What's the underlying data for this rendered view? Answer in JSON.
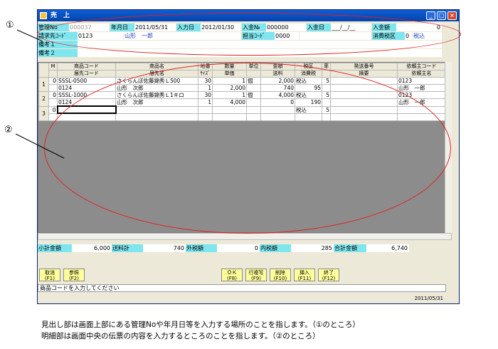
{
  "window": {
    "title": "売　上",
    "min": "_",
    "max": "□",
    "close": "×"
  },
  "header": {
    "kanri_label": "管理No",
    "kanri_value": "000037",
    "nengappi_label": "年月日",
    "nengappi_value": "2011/05/31",
    "nyuryokubi_label": "入力日",
    "nyuryokubi_value": "2012/01/30",
    "nyukin_no_label": "入金№",
    "nyukin_no_value": "000000",
    "nyukinbi_label": "入金日",
    "nyukinbi_value": "___/__/__",
    "nyukin_gaku_label": "入金額",
    "nyukin_gaku_value": "0",
    "seikyu_label": "請求先ｺｰﾄﾞ",
    "seikyu_code": "0123",
    "seikyu_name": "山形　一郎",
    "tanto_label": "担当ｺｰﾄﾞ",
    "tanto_value": "0000",
    "tax_label": "消費税区",
    "tax_code": "0",
    "tax_name": "税込",
    "biko1_label": "備考１",
    "biko2_label": "備考２"
  },
  "detail": {
    "header1": [
      "M",
      "商品コード",
      "商品名",
      "地番",
      "数量",
      "単位",
      "金額",
      "税区",
      "率",
      "発送番号",
      "依頼主コード"
    ],
    "header2": [
      "届先コード",
      "届先名",
      "ｻｲｽﾞ",
      "単価",
      "送料",
      "消費税",
      "摘要",
      "依頼主名"
    ],
    "rows": [
      {
        "no": "1",
        "m": "0",
        "code": "SSSL-0500",
        "name": "さくらんぼ佐藤錦秀Ｌ500",
        "chiban": "30",
        "qty": "1",
        "unit": "個",
        "amount": "2,000",
        "zeiku": "税込",
        "rate": "5",
        "irai": "0123",
        "dest_code": "0124",
        "dest_name": "山形　次郎",
        "size": "1",
        "tanka": "2,000",
        "soryo": "740",
        "tax": "95",
        "irai_name": "山形　一郎"
      },
      {
        "no": "2",
        "m": "0",
        "code": "SSSL-1000",
        "name": "さくらんぼ佐藤錦秀Ｌ1キロ",
        "chiban": "30",
        "qty": "1",
        "unit": "個",
        "amount": "4,000",
        "zeiku": "税込",
        "rate": "5",
        "irai": "0123",
        "dest_code": "0124",
        "dest_name": "山形　次郎",
        "size": "1",
        "tanka": "4,000",
        "soryo": "0",
        "tax": "190",
        "irai_name": "山形　一郎"
      },
      {
        "no": "3",
        "m": "0",
        "zeiku": "税込",
        "rate": "5"
      }
    ]
  },
  "totals": {
    "shokei_label": "小計金額",
    "shokei_value": "6,000",
    "soryo_label": "送料計",
    "soryo_value": "740",
    "sotozei_label": "外税額",
    "sotozei_value": "0",
    "uchizei_label": "内税額",
    "uchizei_value": "285",
    "gokei_label": "合計金額",
    "gokei_value": "6,740"
  },
  "buttons": {
    "cancel": [
      "取消",
      "(F1)"
    ],
    "ref": [
      "参照",
      "(F2)"
    ],
    "ok": [
      "ＯＫ",
      "(F8)"
    ],
    "rowins": [
      "行複写",
      "(F9)"
    ],
    "del": [
      "削除",
      "(F10)"
    ],
    "ins": [
      "挿入",
      "(F11)"
    ],
    "end": [
      "終了",
      "(F12)"
    ]
  },
  "status": {
    "message": "商品コードを入力してください",
    "date": "2011/05/31"
  },
  "annotations": {
    "mark1": "①",
    "mark2": "②",
    "caption1": "見出し部は画面上部にある管理Noや年月日等を入力する場所のことを指します。（①のところ）",
    "caption2": "明細部は画面中央の伝票の内容を入力するところのことを指します。（②のところ）"
  },
  "colors": {
    "label_bg": "#7fe6ef",
    "button_bg": "#ffff9a",
    "annotation": "#e02020",
    "grid_empty": "#8c8c8c"
  }
}
